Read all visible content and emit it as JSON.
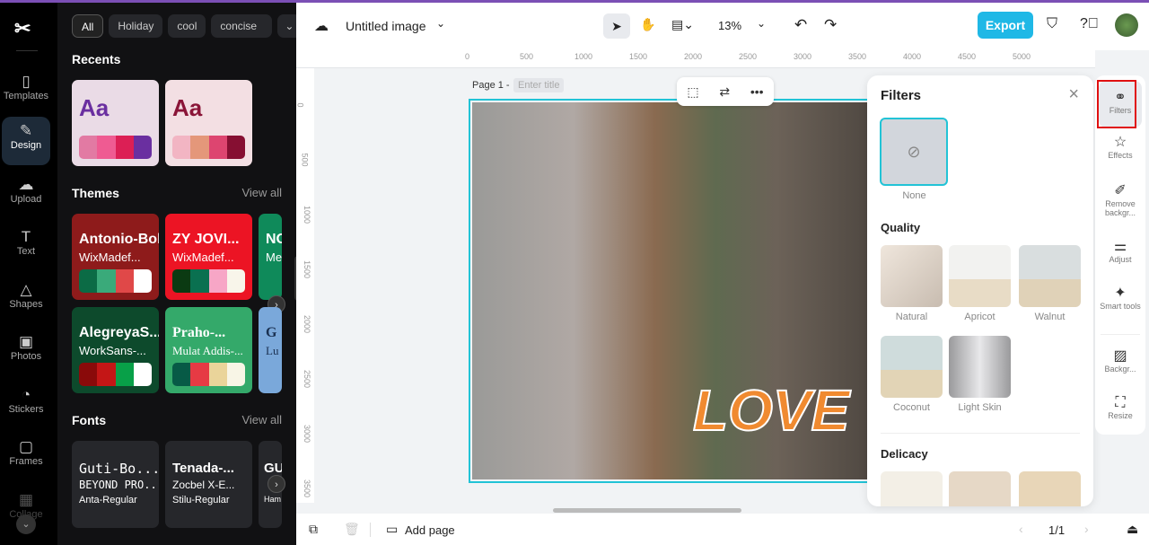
{
  "rail": {
    "items": [
      {
        "label": "Templates",
        "icon": "templates-icon"
      },
      {
        "label": "Design",
        "icon": "design-icon"
      },
      {
        "label": "Upload",
        "icon": "upload-icon"
      },
      {
        "label": "Text",
        "icon": "text-icon"
      },
      {
        "label": "Shapes",
        "icon": "shapes-icon"
      },
      {
        "label": "Photos",
        "icon": "photos-icon"
      },
      {
        "label": "Stickers",
        "icon": "stickers-icon"
      },
      {
        "label": "Frames",
        "icon": "frames-icon"
      },
      {
        "label": "Collage",
        "icon": "collage-icon"
      }
    ]
  },
  "panel": {
    "chips": [
      "All",
      "Holiday",
      "cool",
      "concise"
    ],
    "recents_title": "Recents",
    "recents": [
      {
        "text": "Aa",
        "color": "#6a2fa0",
        "swatches": [
          "#e27aa3",
          "#ef5b92",
          "#dc1f55",
          "#6a2fa0"
        ]
      },
      {
        "text": "Aa",
        "color": "#8a1538",
        "swatches": [
          "#f2b5c3",
          "#e4977a",
          "#dd4570",
          "#860f32"
        ]
      }
    ],
    "themes_title": "Themes",
    "view_all": "View all",
    "themes": [
      {
        "t1": "Antonio-Bold",
        "t2": "WixMadef...",
        "bg": "#8e1b1b",
        "swatches": [
          "#0b6b45",
          "#3aaa7a",
          "#e04848",
          "#ffffff"
        ]
      },
      {
        "t1": "ZY JOVI...",
        "t2": "WixMadef...",
        "bg": "#ec1424",
        "swatches": [
          "#0b3a12",
          "#0a7050",
          "#f7a6c6",
          "#f8f5ea"
        ]
      },
      {
        "t1": "NO",
        "t2": "Me",
        "bg": "#0f8a5a",
        "swatches": [
          "#0a4a30"
        ]
      },
      {
        "t1": "AlegreyaS...",
        "t2": "WorkSans-...",
        "bg": "#0d4a2c",
        "swatches": [
          "#8a0a0a",
          "#c41616",
          "#08a048",
          "#ffffff"
        ]
      },
      {
        "t1": "Praho-...",
        "t2": "Mulat Addis-...",
        "bg": "#34a96a",
        "swatches": [
          "#075a46",
          "#e63a44",
          "#ead49a",
          "#f8f5e6"
        ]
      },
      {
        "t1": "G",
        "t2": "Lu",
        "bg": "#7aa8da",
        "swatches": [
          "#cfd5a6"
        ]
      }
    ],
    "fonts_title": "Fonts",
    "fonts": [
      {
        "l1": "Guti-Bo...",
        "l2": "BEYOND PRO...",
        "l3": "Anta-Regular"
      },
      {
        "l1": "Tenada-...",
        "l2": "Zocbel X-E...",
        "l3": "Stilu-Regular"
      },
      {
        "l1": "GU",
        "l2": "",
        "l3": "Ham"
      }
    ]
  },
  "topbar": {
    "title": "Untitled image",
    "zoom": "13%",
    "export": "Export"
  },
  "ruler": {
    "h": [
      "0",
      "500",
      "1000",
      "1500",
      "2000",
      "2500",
      "3000",
      "3500",
      "4000",
      "4500",
      "5000"
    ],
    "v": [
      "0",
      "500",
      "1000",
      "1500",
      "2000",
      "2500",
      "3000",
      "3500"
    ]
  },
  "canvas": {
    "page_label": "Page 1 -",
    "title_placeholder": "Enter title",
    "sticker_text": "LOVE"
  },
  "filters": {
    "title": "Filters",
    "none": "None",
    "quality_title": "Quality",
    "quality": [
      "Natural",
      "Apricot",
      "Walnut",
      "Coconut",
      "Light Skin"
    ],
    "delicacy_title": "Delicacy"
  },
  "right_rail": [
    {
      "label": "Filters",
      "icon": "filters-icon"
    },
    {
      "label": "Effects",
      "icon": "effects-icon"
    },
    {
      "label": "Remove backgr...",
      "icon": "remove-background-icon"
    },
    {
      "label": "Adjust",
      "icon": "adjust-icon"
    },
    {
      "label": "Smart tools",
      "icon": "smart-tools-icon"
    },
    {
      "label": "Backgr...",
      "icon": "background-icon"
    },
    {
      "label": "Resize",
      "icon": "resize-icon"
    }
  ],
  "bottom": {
    "add_page": "Add page",
    "page_count": "1/1"
  }
}
